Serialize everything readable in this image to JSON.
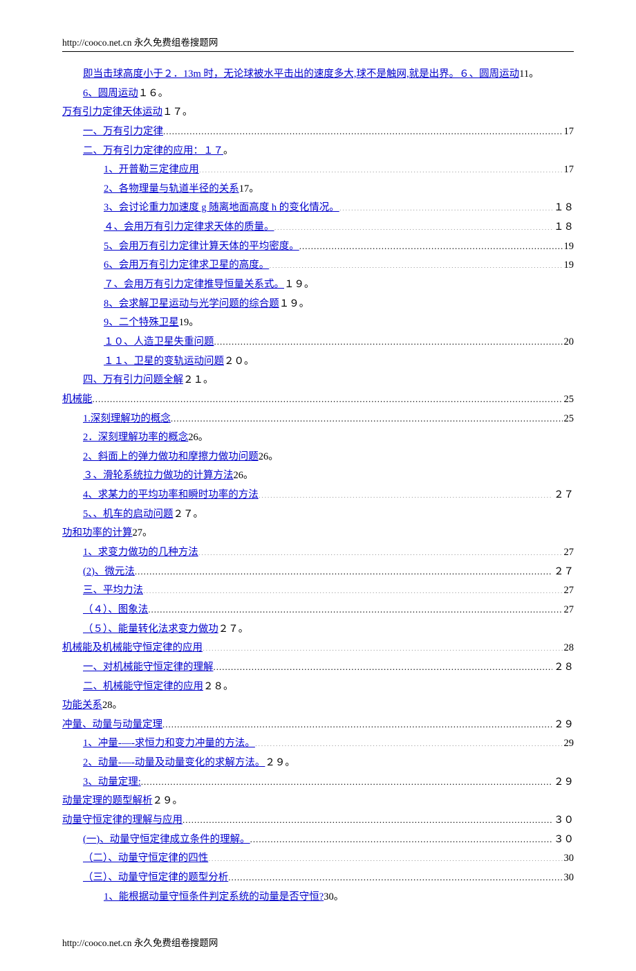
{
  "header": "http://cooco.net.cn  永久免费组卷搜题网",
  "footer": "http://cooco.net.cn  永久免费组卷搜题网",
  "toc": [
    {
      "lvl": 1,
      "text": "即当击球高度小于２．13m 时，无论球被水平击出的速度多大,球不是触网,就是出界。６、圆周运动",
      "tail": "11。",
      "page": null
    },
    {
      "lvl": 1,
      "text": "6、圆周运动",
      "tail": "１６。",
      "page": null
    },
    {
      "lvl": 0,
      "text": "万有引力定律天体运动",
      "tail": "１７。",
      "page": null
    },
    {
      "lvl": 1,
      "text": "一、万有引力定律",
      "tail": null,
      "page": "17"
    },
    {
      "lvl": 1,
      "text": "二、万有引力定律的应用：１７",
      "tail": "。",
      "page": null
    },
    {
      "lvl": 2,
      "text": "1、开普勒三定律应用",
      "tail": null,
      "page": "17"
    },
    {
      "lvl": 2,
      "text": "2、各物理量与轨道半径的关系",
      "tail": "17。",
      "page": null
    },
    {
      "lvl": 2,
      "text": "3、会讨论重力加速度 g 随离地面高度 h 的变化情况。",
      "tail": null,
      "page": "１８"
    },
    {
      "lvl": 2,
      "text": "４、会用万有引力定律求天体的质量。",
      "tail": null,
      "page": "１８"
    },
    {
      "lvl": 2,
      "text": "5、会用万有引力定律计算天体的平均密度。",
      "tail": null,
      "page": "19"
    },
    {
      "lvl": 2,
      "text": "6、会用万有引力定律求卫星的高度。",
      "tail": null,
      "page": "19"
    },
    {
      "lvl": 2,
      "text": "７、会用万有引力定律推导恒量关系式。",
      "tail": "１９。",
      "page": null
    },
    {
      "lvl": 2,
      "text": "8、会求解卫星运动与光学问题的综合题",
      "tail": "１９。",
      "page": null
    },
    {
      "lvl": 2,
      "text": "9、二个特殊卫星",
      "tail": "19。",
      "page": null
    },
    {
      "lvl": 2,
      "text": "１０、人造卫星失重问题",
      "tail": null,
      "page": "20"
    },
    {
      "lvl": 2,
      "text": "１１、卫星的变轨运动问题",
      "tail": "２０。",
      "page": null
    },
    {
      "lvl": 1,
      "text": "四、万有引力问题全解",
      "tail": "２１。",
      "page": null
    },
    {
      "lvl": 0,
      "text": "机械能",
      "tail": null,
      "page": "25"
    },
    {
      "lvl": 1,
      "text": "1.深刻理解功的概念",
      "tail": null,
      "page": "25"
    },
    {
      "lvl": 1,
      "text": "2．深刻理解功率的概念",
      "tail": "26。",
      "page": null
    },
    {
      "lvl": 1,
      "text": "2、斜面上的弹力做功和摩擦力做功问题",
      "tail": "26。",
      "page": null
    },
    {
      "lvl": 1,
      "text": "３、滑轮系统拉力做功的计算方法",
      "tail": "26。",
      "page": null
    },
    {
      "lvl": 1,
      "text": "4、求某力的平均功率和瞬时功率的方法",
      "tail": null,
      "page": "２７"
    },
    {
      "lvl": 1,
      "text": "5、、机车的启动问题",
      "tail": "２７。",
      "page": null
    },
    {
      "lvl": 0,
      "text": "功和功率的计算",
      "tail": "27。",
      "page": null
    },
    {
      "lvl": 1,
      "text": "1、求变力做功的几种方法",
      "tail": null,
      "page": "27"
    },
    {
      "lvl": 1,
      "text": "(2)、微元法",
      "tail": null,
      "page": "２７"
    },
    {
      "lvl": 1,
      "text": "三、平均力法",
      "tail": null,
      "page": "27"
    },
    {
      "lvl": 1,
      "text": "（４）、图象法",
      "tail": null,
      "page": "27"
    },
    {
      "lvl": 1,
      "text": "（５）、能量转化法求变力做功",
      "tail": "２７。",
      "page": null
    },
    {
      "lvl": 0,
      "text": "机械能及机械能守恒定律的应用",
      "tail": null,
      "page": "28"
    },
    {
      "lvl": 1,
      "text": "一、对机械能守恒定律的理解",
      "tail": null,
      "page": "２８"
    },
    {
      "lvl": 1,
      "text": "二、机械能守恒定律的应用",
      "tail": "２８。",
      "page": null
    },
    {
      "lvl": 0,
      "text": "功能关系",
      "tail": "28。",
      "page": null
    },
    {
      "lvl": 0,
      "text": "冲量、动量与动量定理",
      "tail": null,
      "page": "２９"
    },
    {
      "lvl": 1,
      "text": "1、冲量-―-求恒力和变力冲量的方法。",
      "tail": null,
      "page": "29"
    },
    {
      "lvl": 1,
      "text": "2、动量-―-动量及动量变化的求解方法。",
      "tail": "２９。",
      "page": null
    },
    {
      "lvl": 1,
      "text": "3、动量定理:",
      "tail": null,
      "page": "２９"
    },
    {
      "lvl": 0,
      "text": "动量定理的题型解析",
      "tail": "２９。",
      "page": null
    },
    {
      "lvl": 0,
      "text": "动量守恒定律的理解与应用",
      "tail": null,
      "page": "３０"
    },
    {
      "lvl": 1,
      "text": "(一)、动量守恒定律成立条件的理解。",
      "tail": null,
      "page": "３０"
    },
    {
      "lvl": 1,
      "text": "（二）、动量守恒定律的四性",
      "tail": null,
      "page": "30"
    },
    {
      "lvl": 1,
      "text": "（三）、动量守恒定律的题型分析",
      "tail": null,
      "page": "30"
    },
    {
      "lvl": 2,
      "text": "1、能根据动量守恒条件判定系统的动量是否守恒?",
      "tail": "30。",
      "page": null
    }
  ]
}
